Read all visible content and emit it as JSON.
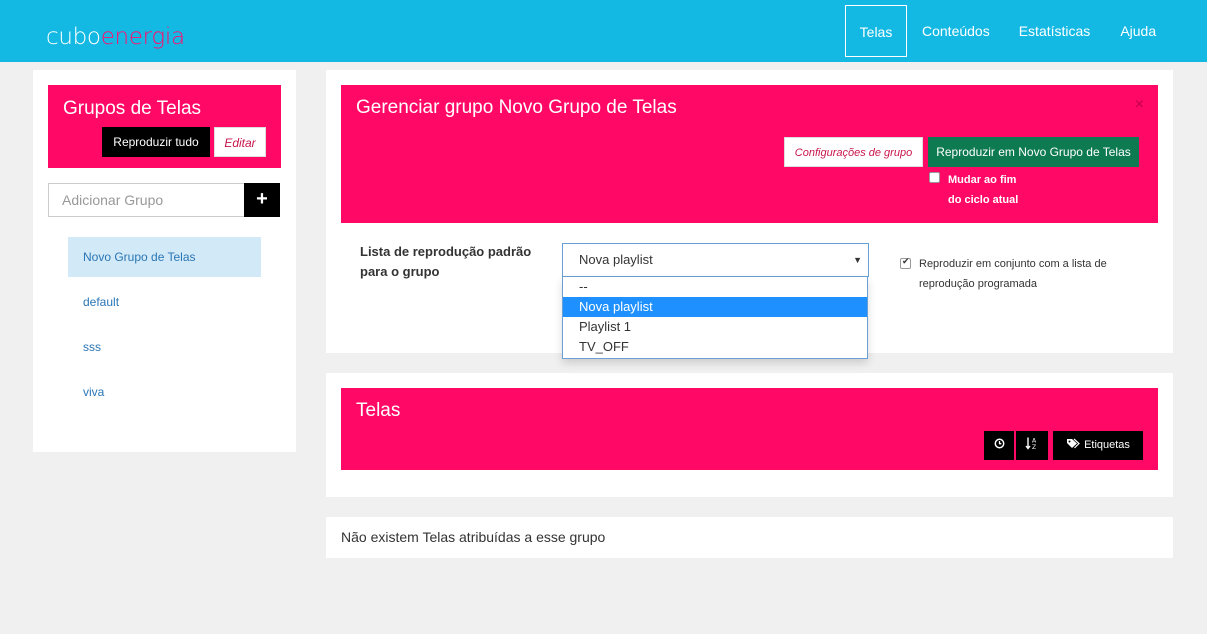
{
  "brand": {
    "part1": "cubo",
    "part2": "energia",
    "color1": "#ffffff",
    "color2": "#ff0f6f"
  },
  "colors": {
    "header": "#14b9e3",
    "accent": "#ff0866",
    "play_group": "#0e7a52",
    "link": "#2a76b5"
  },
  "nav": [
    "Telas",
    "Conteúdos",
    "Estatísticas",
    "Ajuda"
  ],
  "groups": {
    "title": "Grupos de Telas",
    "play_all": "Reproduzir tudo",
    "edit": "Editar",
    "add_placeholder": "Adicionar Grupo",
    "add_icon": "plus-icon",
    "items": [
      "Novo Grupo de Telas",
      "default",
      "sss",
      "viva"
    ],
    "active_index": 0
  },
  "manage": {
    "title": "Gerenciar grupo Novo Grupo de Telas",
    "close": "×",
    "config_button": "Configurações de grupo",
    "play_button": "Reproduzir em Novo Grupo de Telas",
    "switch_label_1": "Mudar ao fim",
    "switch_label_2": "do ciclo atual",
    "playlist_label_1": "Lista de reprodução padrão",
    "playlist_label_2": "para o grupo",
    "playlist_selected": "Nova playlist",
    "playlist_options": [
      "--",
      "Nova playlist",
      "Playlist 1",
      "TV_OFF"
    ],
    "combine_label_1": "Reproduzir em conjunto com a lista de",
    "combine_label_2": "reprodução programada",
    "combine_checked": true
  },
  "telas": {
    "title": "Telas",
    "clock_icon": "clock-icon",
    "sort_icon": "sort-alpha-icon",
    "tags_icon": "tags-icon",
    "tags_label": "Etiquetas"
  },
  "empty_message": "Não existem Telas atribuídas a esse grupo"
}
